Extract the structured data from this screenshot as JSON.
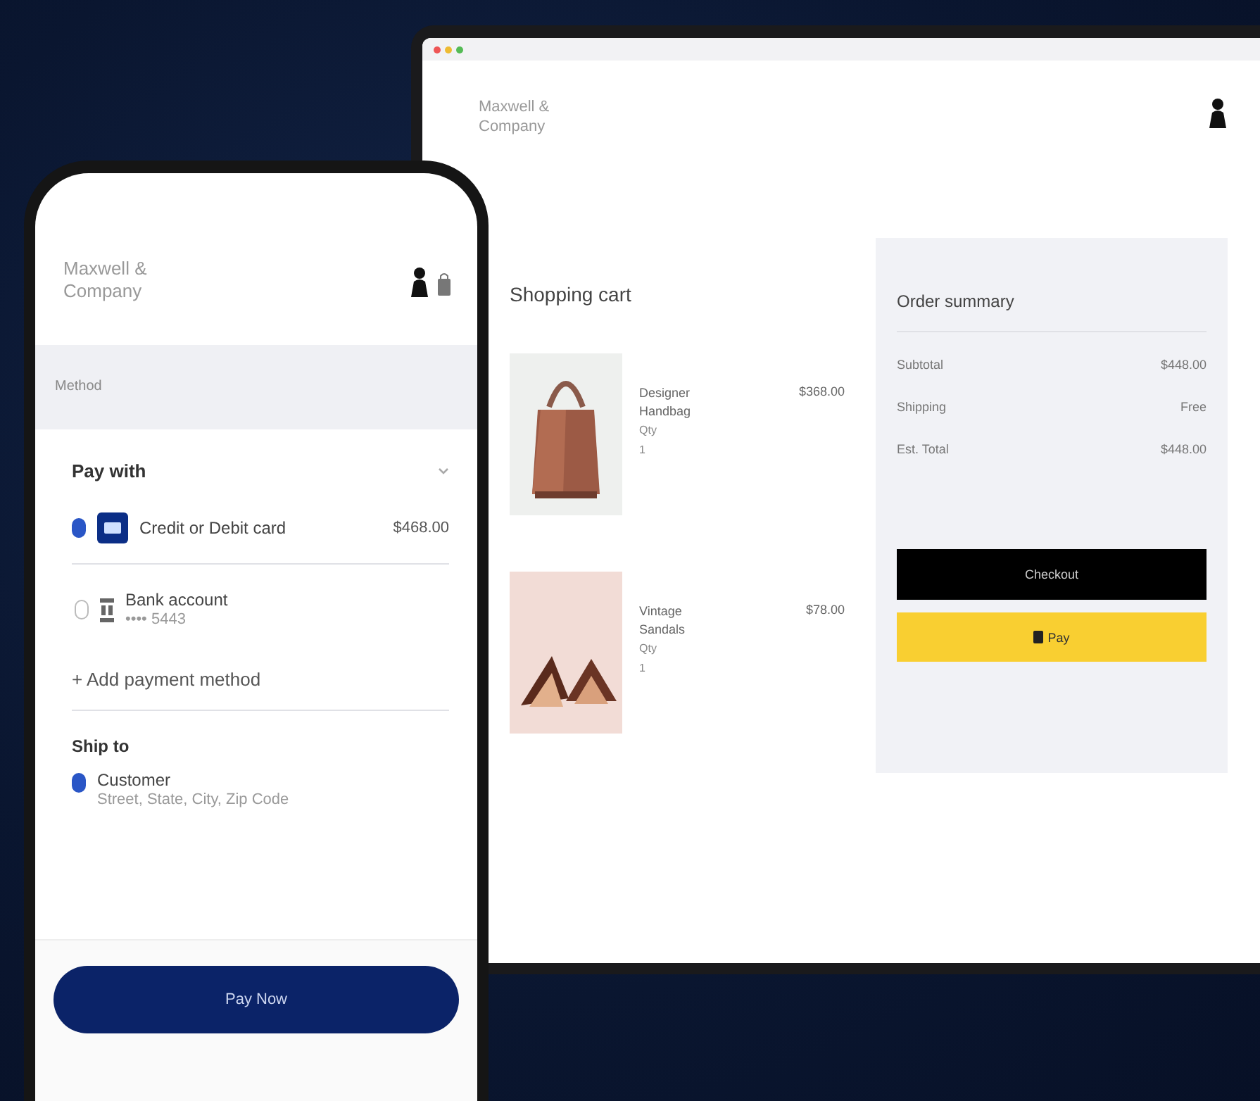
{
  "tablet": {
    "brand": "Maxwell & Company",
    "cart": {
      "title": "Shopping cart",
      "items": [
        {
          "kind": "bag",
          "name": "Designer Handbag",
          "price": "$368.00",
          "qty_label": "Qty",
          "qty": "1"
        },
        {
          "kind": "sandals",
          "name": "Vintage Sandals",
          "price": "$78.00",
          "qty_label": "Qty",
          "qty": "1"
        }
      ]
    },
    "summary": {
      "title": "Order summary",
      "rows": [
        {
          "label": "Subtotal",
          "value": "$448.00"
        },
        {
          "label": "Shipping",
          "value": "Free"
        },
        {
          "label": "Est. Total",
          "value": "$448.00"
        }
      ],
      "checkout_button": "Checkout",
      "pay_button": "Pay"
    }
  },
  "phone": {
    "brand": "Maxwell & Company",
    "section_label": "Method",
    "pay_with": "Pay with",
    "payment_methods": [
      {
        "kind": "card",
        "label": "Credit or Debit card",
        "amount": "$468.00",
        "selected": true
      },
      {
        "kind": "bank",
        "label": "Bank account",
        "detail": "•••• 5443",
        "selected": false
      }
    ],
    "add_method": "+ Add payment method",
    "ship_to": {
      "title": "Ship to",
      "addresses": [
        {
          "name": "Customer",
          "address": "Street, State, City, Zip Code",
          "selected": true
        }
      ]
    },
    "pay_button": "Pay Now"
  }
}
